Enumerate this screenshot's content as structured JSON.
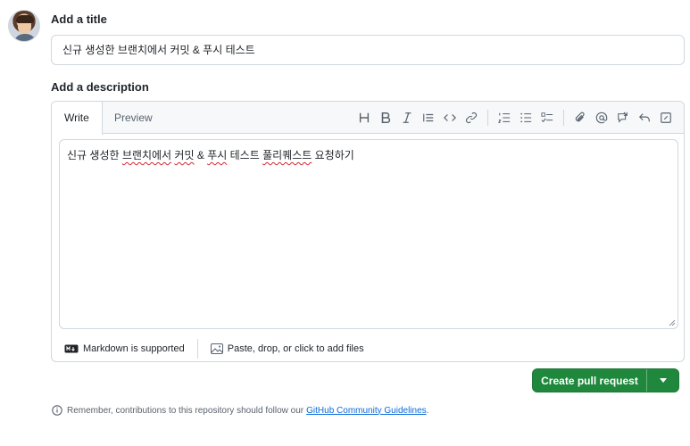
{
  "title_section": {
    "label": "Add a title",
    "value": "신규 생성한 브랜치에서 커밋 & 푸시 테스트"
  },
  "description_section": {
    "label": "Add a description",
    "tabs": [
      {
        "label": "Write",
        "active": true
      },
      {
        "label": "Preview",
        "active": false
      }
    ],
    "toolbar_icons": [
      "heading-icon",
      "bold-icon",
      "italic-icon",
      "quote-icon",
      "code-icon",
      "link-icon",
      "ordered-list-icon",
      "unordered-list-icon",
      "task-list-icon",
      "attach-icon",
      "mention-icon",
      "reference-icon",
      "undo-icon",
      "fullscreen-icon"
    ],
    "body_parts": {
      "p1": "신규 생성한 ",
      "p2": "브랜치에서",
      "p3": " ",
      "p4": "커밋",
      "p5": " & ",
      "p6": "푸시",
      "p7": " 테스트 ",
      "p8": "풀리퀘스트",
      "p9": " 요청하기"
    },
    "footer": {
      "markdown": "Markdown is supported",
      "attach": "Paste, drop, or click to add files"
    }
  },
  "actions": {
    "create_label": "Create pull request"
  },
  "notice": {
    "text": "Remember, contributions to this repository should follow our",
    "link": "GitHub Community Guidelines",
    "end": "."
  },
  "colors": {
    "primary": "#1f883d",
    "link": "#0969da",
    "spellcheck": "#d1242f"
  }
}
